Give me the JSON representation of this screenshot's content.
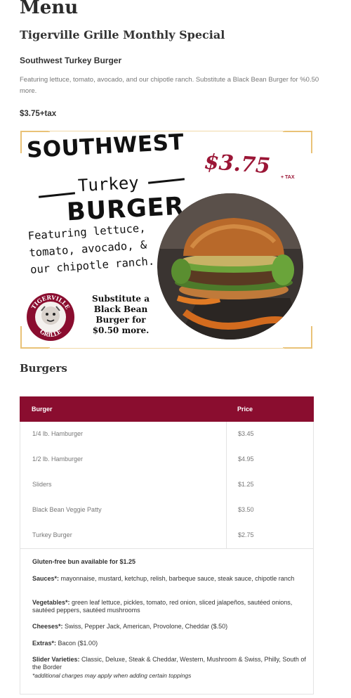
{
  "page": {
    "title": "Menu"
  },
  "special": {
    "heading": "Tigerville Grille Monthly Special",
    "item_name": "Southwest Turkey Burger",
    "description": "Featuring lettuce, tomato, avocado, and our chipotle ranch. Substitute a Black Bean Burger for %0.50 more.",
    "price": "$3.75+tax"
  },
  "promo": {
    "headline": "SOUTHWEST",
    "turkey": "Turkey",
    "burger": "BURGER",
    "price": "$3.75",
    "tax": "+ TAX",
    "features": "Featuring lettuce, tomato, avocado, & our chipotle ranch.",
    "substitute": "Substitute a Black Bean Burger for $0.50 more.",
    "logo_top": "TIGERVILLE",
    "logo_bottom": "GRILLE",
    "accent_color": "#9b1636",
    "frame_color": "#e9c277"
  },
  "burgers": {
    "heading": "Burgers",
    "columns": [
      "Burger",
      "Price"
    ],
    "rows": [
      {
        "name": "1/4 lb. Hamburger",
        "price": "$3.45"
      },
      {
        "name": "1/2 lb. Hamburger",
        "price": "$4.95"
      },
      {
        "name": "Sliders",
        "price": "$1.25"
      },
      {
        "name": "Black Bean Veggie Patty",
        "price": "$3.50"
      },
      {
        "name": "Turkey Burger",
        "price": "$2.75"
      }
    ],
    "header_color": "#8a0d2f",
    "gluten_free": "Gluten-free bun available for $1.25",
    "sauces_label": "Sauces*:",
    "sauces": " mayonnaise, mustard, ketchup, relish, barbeque sauce, steak sauce, chipotle ranch",
    "vegetables_label": "Vegetables*:",
    "vegetables": " green leaf lettuce, pickles, tomato, red onion, sliced jalapeños, sautéed onions, sautéed peppers, sautéed mushrooms",
    "cheeses_label": "Cheeses*:",
    "cheeses": " Swiss, Pepper Jack, American, Provolone, Cheddar ($.50)",
    "extras_label": "Extras*:",
    "extras": " Bacon ($1.00)",
    "slider_label": "Slider Varieties:",
    "slider": " Classic, Deluxe, Steak & Cheddar, Western, Mushroom & Swiss, Philly, South of the Border",
    "footnote": "*additional charges may apply when adding certain toppings"
  }
}
